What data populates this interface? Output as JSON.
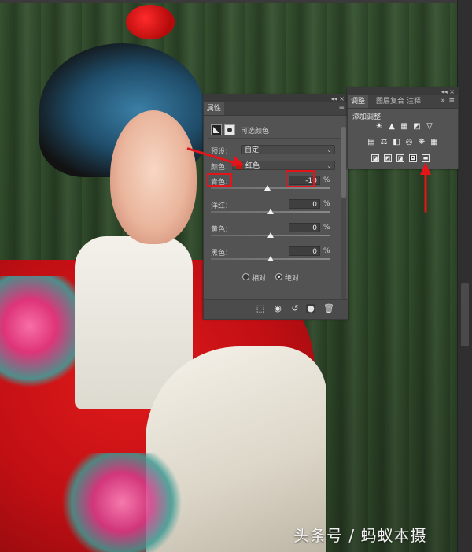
{
  "properties_panel": {
    "tab_label": "属性",
    "topbar_controls": "◂◂  ×",
    "title": "可选颜色",
    "preset": {
      "label": "预设：",
      "value": "自定"
    },
    "colors": {
      "label": "颜色：",
      "value": "红色",
      "swatch_color": "#c8140e"
    },
    "sliders": [
      {
        "label": "青色：",
        "value": "-10",
        "unit": "%",
        "position_fraction": 0.475
      },
      {
        "label": "洋红：",
        "value": "0",
        "unit": "%",
        "position_fraction": 0.5
      },
      {
        "label": "黄色：",
        "value": "0",
        "unit": "%",
        "position_fraction": 0.5
      },
      {
        "label": "黑色：",
        "value": "0",
        "unit": "%",
        "position_fraction": 0.5
      }
    ],
    "method": {
      "relative_label": "相对",
      "absolute_label": "绝对",
      "selected": "absolute"
    },
    "bottom_icons": [
      "clip-to-layer-icon",
      "view-previous-icon",
      "reset-icon",
      "visibility-icon",
      "delete-icon"
    ]
  },
  "adjustments_panel": {
    "tabs": [
      {
        "label": "调整",
        "active": true
      },
      {
        "label": "图层复合",
        "active": false
      },
      {
        "label": "注释",
        "active": false
      }
    ],
    "topbar_controls": "◂◂  ×",
    "collapse_glyph": "»",
    "title": "添加调整",
    "rows": [
      [
        "☀",
        "▲",
        "▦",
        "◩",
        "▽"
      ],
      [
        "▤",
        "⚖",
        "◧",
        "◎",
        "❋",
        "▦"
      ],
      [
        "◪",
        "◩",
        "◪",
        "◘",
        "▬"
      ]
    ]
  },
  "annotations": {
    "color": "#e3151b"
  },
  "watermark": "头条号 / 蚂蚁本摄"
}
